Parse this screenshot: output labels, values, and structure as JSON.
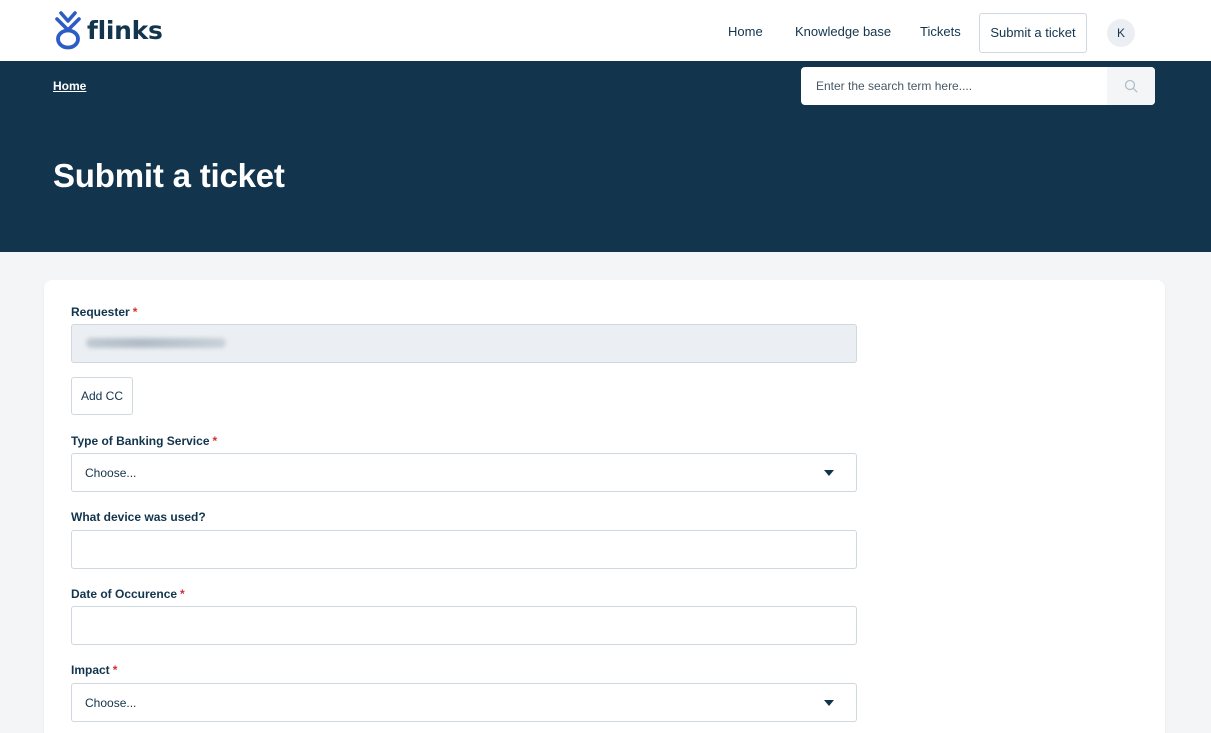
{
  "brand": {
    "name": "flinks"
  },
  "nav": {
    "home": "Home",
    "knowledge_base": "Knowledge base",
    "tickets": "Tickets",
    "submit_ticket": "Submit a ticket",
    "avatar_initial": "K"
  },
  "hero": {
    "breadcrumb": "Home",
    "search_placeholder": "Enter the search term here....",
    "title": "Submit a ticket"
  },
  "form": {
    "requester": {
      "label": "Requester",
      "required": "*"
    },
    "add_cc": "Add CC",
    "banking_service": {
      "label": "Type of Banking Service",
      "required": "*",
      "value": "Choose..."
    },
    "device": {
      "label": "What device was used?",
      "value": ""
    },
    "date": {
      "label": "Date of Occurence",
      "required": "*",
      "value": ""
    },
    "impact": {
      "label": "Impact",
      "required": "*",
      "value": "Choose..."
    }
  },
  "colors": {
    "primary": "#12344d",
    "required": "#d72d30",
    "logo_accent": "#2c5cc5"
  },
  "icons": [
    "flinks-logo-icon",
    "search-icon",
    "chevron-down-icon"
  ]
}
